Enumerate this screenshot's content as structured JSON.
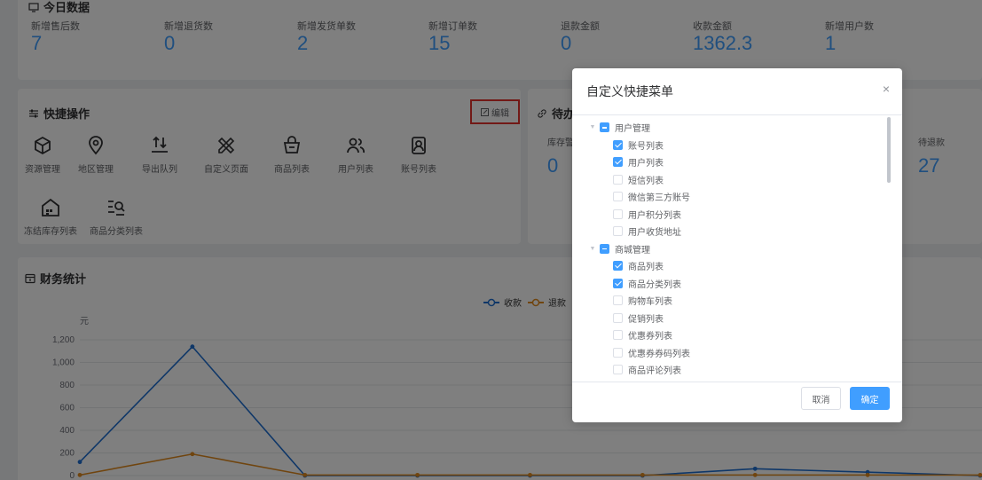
{
  "today": {
    "title": "今日数据",
    "stats": [
      {
        "label": "新增售后数",
        "value": "7"
      },
      {
        "label": "新增退货数",
        "value": "0"
      },
      {
        "label": "新增发货单数",
        "value": "2"
      },
      {
        "label": "新增订单数",
        "value": "15"
      },
      {
        "label": "退款金额",
        "value": "0"
      },
      {
        "label": "收款金额",
        "value": "1362.3"
      },
      {
        "label": "新增用户数",
        "value": "1"
      }
    ]
  },
  "quick": {
    "title": "快捷操作",
    "edit_label": "编辑",
    "items": [
      {
        "label": "资源管理",
        "icon": "cube-icon"
      },
      {
        "label": "地区管理",
        "icon": "location-icon"
      },
      {
        "label": "导出队列",
        "icon": "export-icon"
      },
      {
        "label": "自定义页面",
        "icon": "ruler-pencil-icon"
      },
      {
        "label": "商品列表",
        "icon": "basket-icon"
      },
      {
        "label": "用户列表",
        "icon": "users-icon"
      },
      {
        "label": "账号列表",
        "icon": "account-icon"
      },
      {
        "label": "冻结库存列表",
        "icon": "warehouse-icon"
      },
      {
        "label": "商品分类列表",
        "icon": "category-search-icon"
      }
    ]
  },
  "todo": {
    "title": "待办事",
    "left_label": "库存警",
    "left_value": "0",
    "right_label": "待退款",
    "right_value": "27"
  },
  "finance": {
    "title": "财务统计"
  },
  "chart_data": {
    "type": "line",
    "title": "",
    "ylabel": "元",
    "ylim": [
      0,
      1200
    ],
    "yticks": [
      "0",
      "200",
      "400",
      "600",
      "800",
      "1,000",
      "1,200"
    ],
    "legend": "top-center",
    "series": [
      {
        "name": "收款",
        "color": "#1f6fd1",
        "values": [
          120,
          1140,
          0,
          0,
          0,
          0,
          60,
          30,
          0
        ]
      },
      {
        "name": "退款",
        "color": "#e08a1e",
        "values": [
          5,
          190,
          5,
          5,
          5,
          5,
          5,
          5,
          5
        ]
      }
    ]
  },
  "dialog": {
    "title": "自定义快捷菜单",
    "close": "×",
    "cancel_label": "取消",
    "ok_label": "确定",
    "tree": [
      {
        "label": "用户管理",
        "level": 0,
        "state": "indeterminate"
      },
      {
        "label": "账号列表",
        "level": 1,
        "state": "checked"
      },
      {
        "label": "用户列表",
        "level": 1,
        "state": "checked"
      },
      {
        "label": "短信列表",
        "level": 1,
        "state": "unchecked"
      },
      {
        "label": "微信第三方账号",
        "level": 1,
        "state": "unchecked"
      },
      {
        "label": "用户积分列表",
        "level": 1,
        "state": "unchecked"
      },
      {
        "label": "用户收货地址",
        "level": 1,
        "state": "unchecked"
      },
      {
        "label": "商城管理",
        "level": 0,
        "state": "indeterminate"
      },
      {
        "label": "商品列表",
        "level": 1,
        "state": "checked"
      },
      {
        "label": "商品分类列表",
        "level": 1,
        "state": "checked"
      },
      {
        "label": "购物车列表",
        "level": 1,
        "state": "unchecked"
      },
      {
        "label": "促销列表",
        "level": 1,
        "state": "unchecked"
      },
      {
        "label": "优惠券列表",
        "level": 1,
        "state": "unchecked"
      },
      {
        "label": "优惠券券码列表",
        "level": 1,
        "state": "unchecked"
      },
      {
        "label": "商品评论列表",
        "level": 1,
        "state": "unchecked"
      }
    ]
  },
  "colors": {
    "accent": "#409eff",
    "highlight_border": "#e5322d"
  }
}
